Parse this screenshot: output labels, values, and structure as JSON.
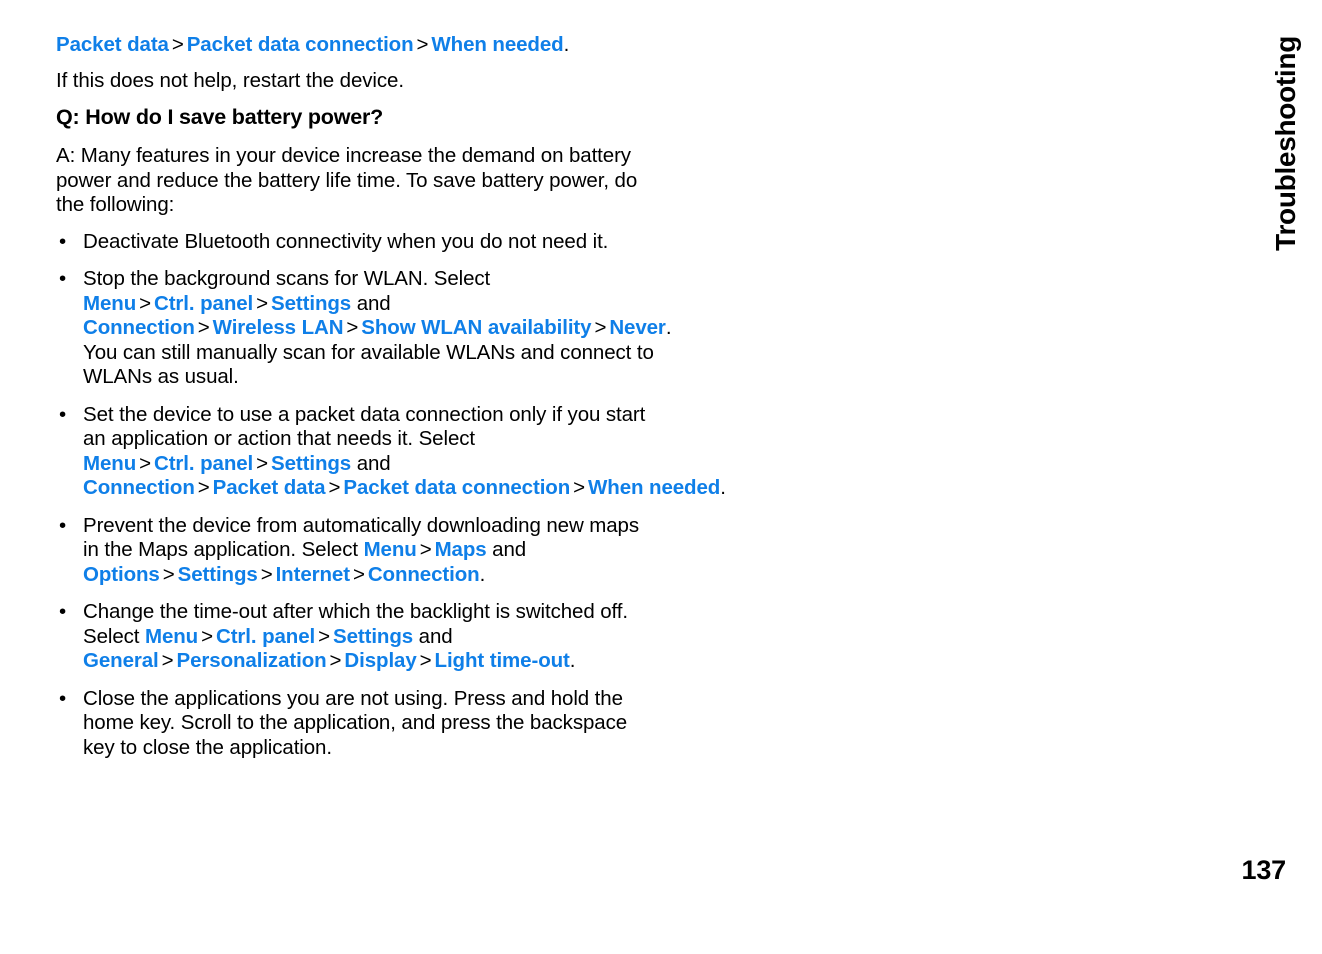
{
  "document": {
    "chapter_title": "Troubleshooting",
    "page_number": "137",
    "link_color": "#0f7fe8",
    "text_color": "#000000",
    "background_color": "#ffffff"
  },
  "content": {
    "continued_path": {
      "items": [
        "Packet data",
        "Packet data connection",
        "When needed"
      ],
      "separator": ">",
      "trailing": "."
    },
    "restart_note": "If this does not help, restart the device.",
    "question_heading": "Q: How do I save battery power?",
    "answer_intro": "A: Many features in your device increase the demand on battery power and reduce the battery life time. To save battery power, do the following:",
    "bullet_marker": "•",
    "bullets": [
      {
        "id": "bluetooth",
        "text": "Deactivate Bluetooth connectivity when you do not need it."
      },
      {
        "id": "wlan-scan",
        "lead": "Stop the background scans for WLAN. Select ",
        "path": [
          "Menu",
          "Ctrl. panel",
          "Settings"
        ],
        "conjunction": " and ",
        "path2": [
          "Connection",
          "Wireless LAN",
          "Show WLAN availability",
          "Never"
        ],
        "separator": ">",
        "tail": ". You can still manually scan for available WLANs and connect to WLANs as usual."
      },
      {
        "id": "packet-data",
        "lead": "Set the device to use a packet data connection only if you start an application or action that needs it. Select ",
        "path": [
          "Menu",
          "Ctrl. panel",
          "Settings"
        ],
        "conjunction": " and ",
        "path2": [
          "Connection",
          "Packet data",
          "Packet data connection",
          "When needed"
        ],
        "separator": ">",
        "tail": "."
      },
      {
        "id": "maps-download",
        "lead": "Prevent the device from automatically downloading new maps in the Maps application. Select ",
        "path": [
          "Menu",
          "Maps"
        ],
        "conjunction": " and ",
        "path2": [
          "Options",
          "Settings",
          "Internet",
          "Connection"
        ],
        "separator": ">",
        "tail": "."
      },
      {
        "id": "light-timeout",
        "lead": "Change the time-out after which the backlight is switched off. Select ",
        "path": [
          "Menu",
          "Ctrl. panel",
          "Settings"
        ],
        "conjunction": " and ",
        "path2": [
          "General",
          "Personalization",
          "Display",
          "Light time-out"
        ],
        "separator": ">",
        "tail": "."
      },
      {
        "id": "close-apps",
        "text": "Close the applications you are not using. Press and hold the home key. Scroll to the application, and press the backspace key to close the application."
      }
    ]
  }
}
